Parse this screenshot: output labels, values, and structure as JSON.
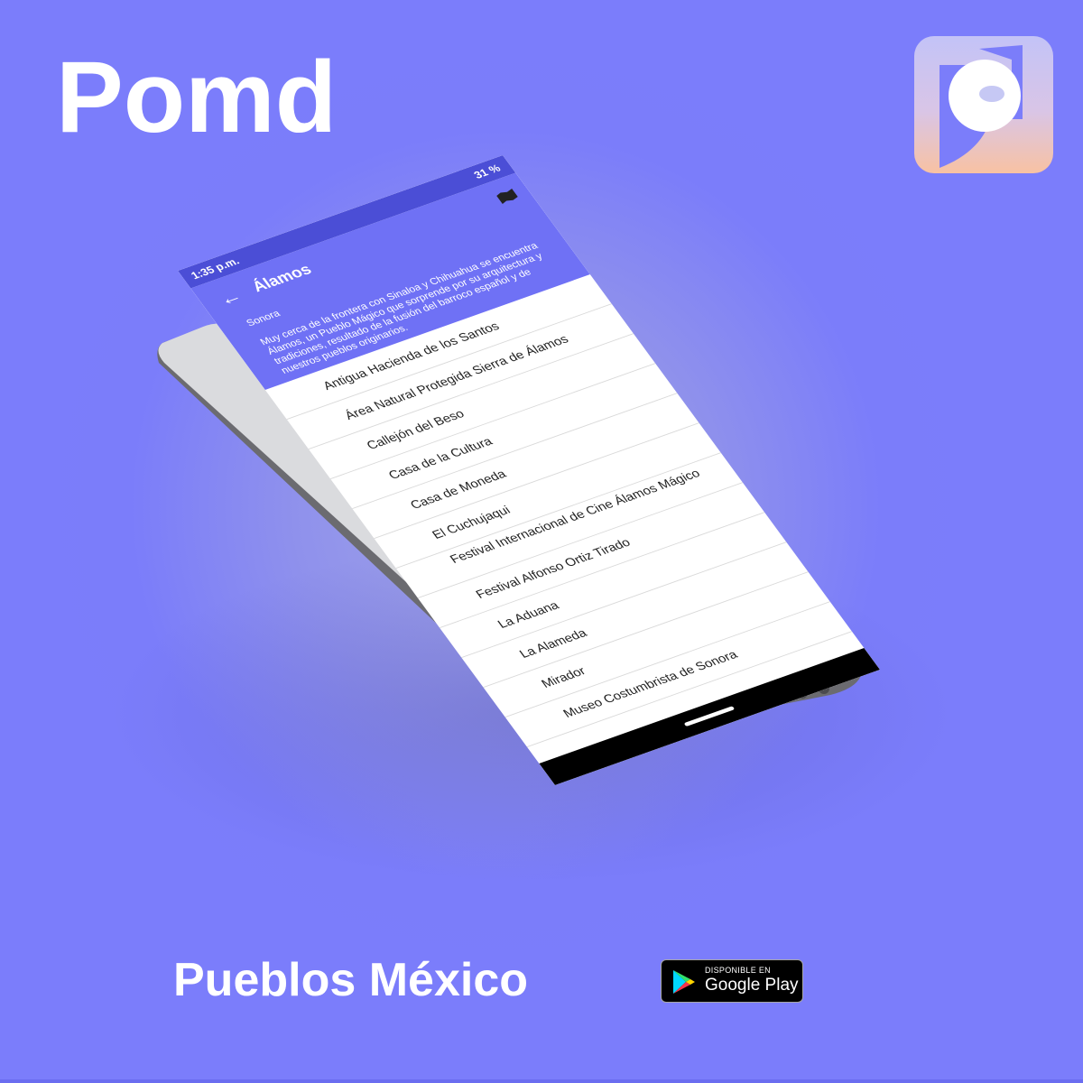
{
  "app_title": "Pomd",
  "subtitle": "Pueblos México",
  "store_badge": {
    "small_text": "DISPONIBLE EN",
    "big_text": "Google Play"
  },
  "phone": {
    "status": {
      "time": "1:35 p.m.",
      "battery": "31 %"
    },
    "appbar": {
      "title": "Álamos",
      "state": "Sonora",
      "description": "Muy cerca de la frontera con Sinaloa y Chihuahua se encuentra Álamos, un Pueblo Mágico que sorprende por su arquitectura y tradiciones, resultado de la fusión del barroco español y de nuestros pueblos originarios."
    },
    "items": [
      "Antigua Hacienda de los Santos",
      "Área Natural Protegida Sierra de Álamos",
      "Callejón del Beso",
      "Casa de la Cultura",
      "Casa de Moneda",
      "El Cuchujaqui",
      "Festival Internacional de Cine Álamos Mágico",
      "Festival Alfonso Ortiz Tirado",
      "La Aduana",
      "La Alameda",
      "Mirador",
      "Museo Costumbrista de Sonora"
    ]
  },
  "colors": {
    "background": "#7b7dfb",
    "appbar": "#6f71f5",
    "statusbar": "#4b4ed6",
    "phone_body": "#dadbde"
  }
}
